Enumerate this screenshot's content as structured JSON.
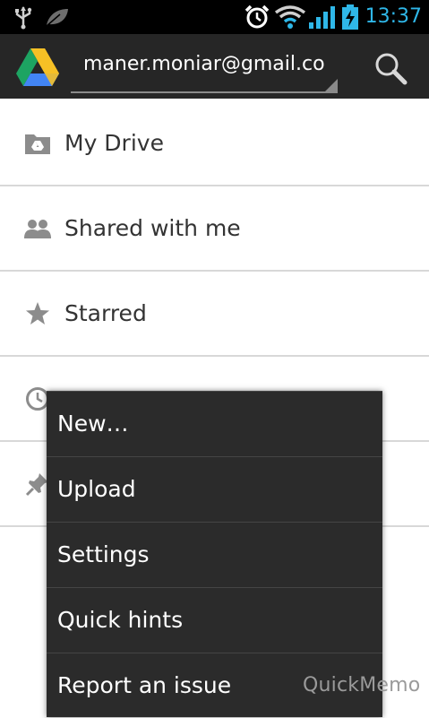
{
  "status_bar": {
    "time": "13:37",
    "accent_color": "#2fb7e8",
    "icons": [
      "usb-icon",
      "leaf-icon",
      "alarm-icon",
      "wifi-icon",
      "signal-icon",
      "battery-charging-icon"
    ]
  },
  "action_bar": {
    "app_logo": "google-drive-logo",
    "account": "maner.moniar@gmail.com",
    "search_icon": "search-icon"
  },
  "nav_list": {
    "items": [
      {
        "label": "My Drive",
        "icon": "drive-folder-icon"
      },
      {
        "label": "Shared with me",
        "icon": "people-icon"
      },
      {
        "label": "Starred",
        "icon": "star-icon"
      },
      {
        "label": "",
        "icon": "clock-icon"
      },
      {
        "label": "",
        "icon": "pin-icon"
      }
    ]
  },
  "overflow_menu": {
    "items": [
      {
        "label": "New…"
      },
      {
        "label": "Upload"
      },
      {
        "label": "Settings"
      },
      {
        "label": "Quick hints"
      },
      {
        "label": "Report an issue"
      }
    ]
  },
  "watermark": "QuickMemo"
}
